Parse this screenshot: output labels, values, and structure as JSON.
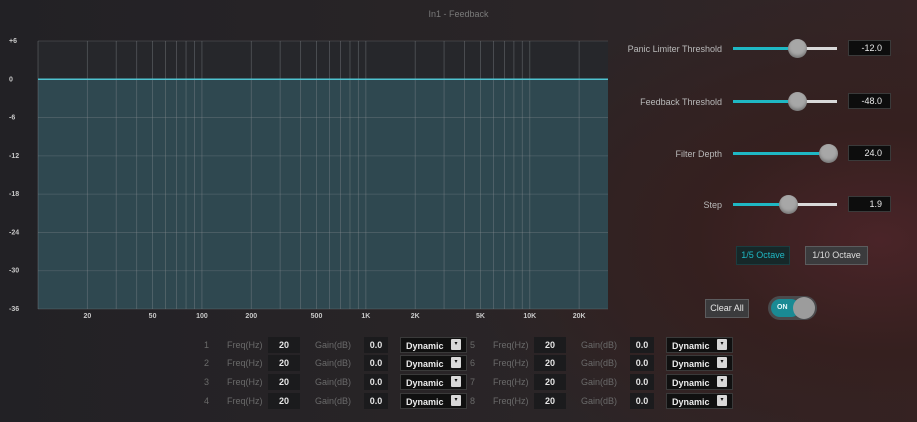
{
  "window": {
    "title": "In1 - Feedback"
  },
  "chart_data": {
    "type": "line",
    "x_axis": {
      "scale": "log",
      "range": [
        10,
        30000
      ],
      "tick_labels": [
        "20",
        "50",
        "100",
        "200",
        "500",
        "1K",
        "2K",
        "5K",
        "10K",
        "20K"
      ]
    },
    "y_axis": {
      "range": [
        -36,
        6
      ],
      "tick_labels": [
        "+6",
        "0",
        "-6",
        "-12",
        "-18",
        "-24",
        "-30",
        "-36"
      ]
    },
    "series": [
      {
        "x": [
          10,
          30000
        ],
        "y": [
          0,
          0
        ],
        "color": "#4fc3d0"
      }
    ],
    "grid": true
  },
  "sliders": [
    {
      "label": "Panic Limiter Threshold",
      "value": "-12.0",
      "fraction": 0.62
    },
    {
      "label": "Feedback Threshold",
      "value": "-48.0",
      "fraction": 0.62
    },
    {
      "label": "Filter Depth",
      "value": "24.0",
      "fraction": 0.92
    },
    {
      "label": "Step",
      "value": "1.9",
      "fraction": 0.53
    }
  ],
  "octave": {
    "options": [
      "1/5 Octave",
      "1/10 Octave"
    ],
    "selected": "1/5 Octave"
  },
  "clear_all_label": "Clear All",
  "toggle": {
    "label": "ON",
    "state": "on"
  },
  "filters": [
    {
      "index": "1",
      "freq_label": "Freq(Hz)",
      "freq": "20",
      "gain_label": "Gain(dB)",
      "gain": "0.0",
      "type": "Dynamic"
    },
    {
      "index": "2",
      "freq_label": "Freq(Hz)",
      "freq": "20",
      "gain_label": "Gain(dB)",
      "gain": "0.0",
      "type": "Dynamic"
    },
    {
      "index": "3",
      "freq_label": "Freq(Hz)",
      "freq": "20",
      "gain_label": "Gain(dB)",
      "gain": "0.0",
      "type": "Dynamic"
    },
    {
      "index": "4",
      "freq_label": "Freq(Hz)",
      "freq": "20",
      "gain_label": "Gain(dB)",
      "gain": "0.0",
      "type": "Dynamic"
    },
    {
      "index": "5",
      "freq_label": "Freq(Hz)",
      "freq": "20",
      "gain_label": "Gain(dB)",
      "gain": "0.0",
      "type": "Dynamic"
    },
    {
      "index": "6",
      "freq_label": "Freq(Hz)",
      "freq": "20",
      "gain_label": "Gain(dB)",
      "gain": "0.0",
      "type": "Dynamic"
    },
    {
      "index": "7",
      "freq_label": "Freq(Hz)",
      "freq": "20",
      "gain_label": "Gain(dB)",
      "gain": "0.0",
      "type": "Dynamic"
    },
    {
      "index": "8",
      "freq_label": "Freq(Hz)",
      "freq": "20",
      "gain_label": "Gain(dB)",
      "gain": "0.0",
      "type": "Dynamic"
    }
  ]
}
